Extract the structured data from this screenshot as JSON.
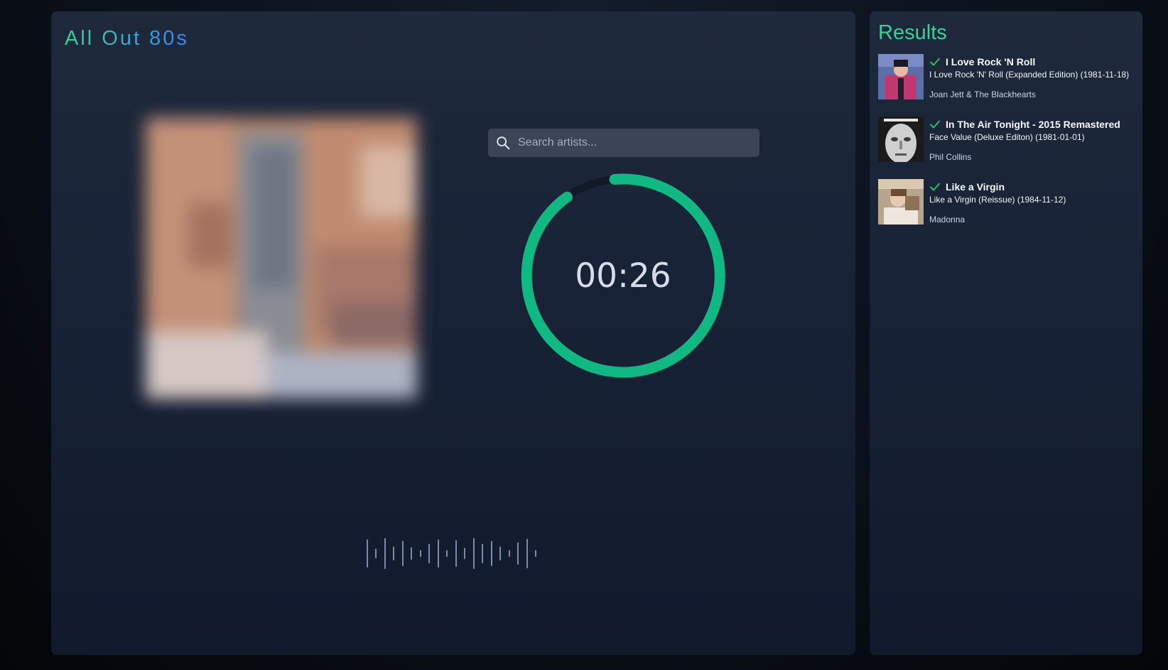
{
  "playlist": {
    "title": "All Out 80s"
  },
  "search": {
    "placeholder": "Search artists..."
  },
  "timer": {
    "display": "00:26"
  },
  "results": {
    "title": "Results",
    "items": [
      {
        "title": "I Love Rock 'N Roll",
        "album": "I Love Rock 'N' Roll (Expanded Edition) (1981-11-18)",
        "artist": "Joan Jett & The Blackhearts"
      },
      {
        "title": "In The Air Tonight - 2015 Remastered",
        "album": "Face Value (Deluxe Editon) (1981-01-01)",
        "artist": "Phil Collins"
      },
      {
        "title": "Like a Virgin",
        "album": "Like a Virgin (Reissue) (1984-11-12)",
        "artist": "Madonna"
      }
    ]
  },
  "colors": {
    "accent": "#10b981",
    "check": "#22c55e",
    "title_gradient_start": "#34d399",
    "title_gradient_end": "#3b82f6"
  },
  "icons": {
    "search": "search-icon",
    "check": "check-icon"
  }
}
